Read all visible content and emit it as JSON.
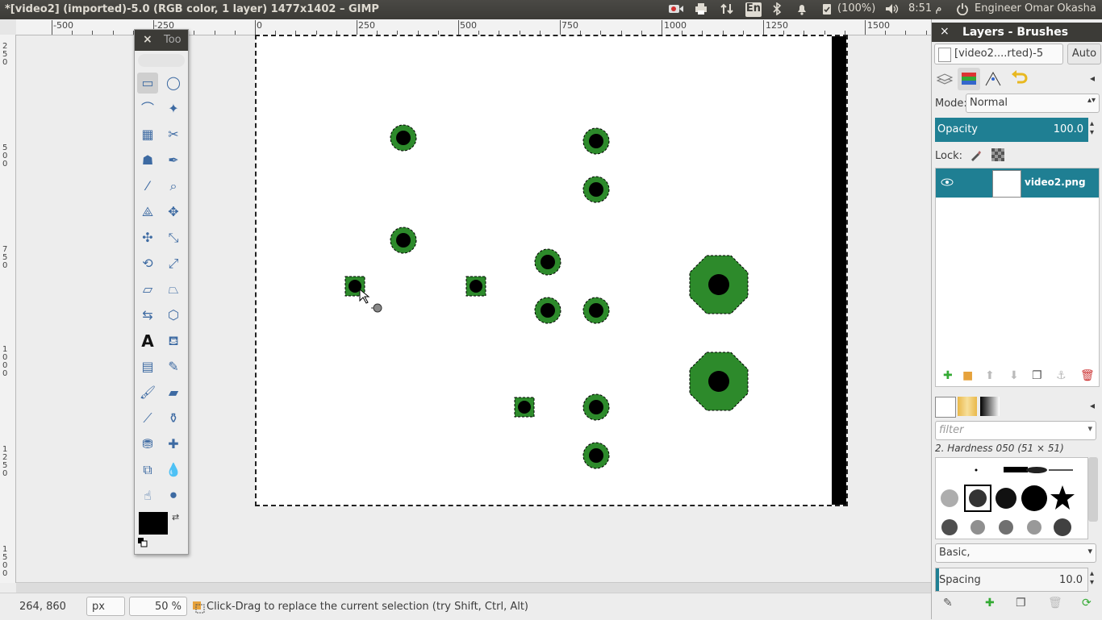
{
  "window": {
    "title": "*[video2] (imported)-5.0 (RGB color, 1 layer) 1477x1402 – GIMP"
  },
  "system": {
    "lang": "En",
    "battery": "(100%)",
    "time": "8:51 م",
    "user": "Engineer Omar Okasha"
  },
  "ruler": {
    "labels": [
      "-500",
      "-250",
      "0",
      "250",
      "500",
      "750",
      "1000",
      "1250",
      "1500"
    ],
    "vlabels": [
      "250",
      "500",
      "750",
      "1000",
      "1250",
      "1500"
    ]
  },
  "toolbox": {
    "close": "×",
    "title": "Too"
  },
  "status": {
    "coords": "264, 860",
    "unit": "px",
    "zoom": "50 %",
    "message": "Click-Drag to replace the current selection (try Shift, Ctrl, Alt)"
  },
  "panel": {
    "close": "×",
    "title": "Layers - Brushes",
    "image_select": "[video2....rted)-5",
    "auto_button": "Auto",
    "mode_label": "Mode:",
    "mode_value": "Normal",
    "opacity_label": "Opacity",
    "opacity_value": "100.0",
    "lock_label": "Lock:",
    "layer_name": "video2.png",
    "brush_filter_placeholder": "filter",
    "brush_name": "2. Hardness 050 (51 × 51)",
    "brush_tag": "Basic,",
    "spacing_label": "Spacing",
    "spacing_value": "10.0"
  },
  "colors": {
    "topbar": "#3c3b37",
    "green": "#2d8a2b",
    "accent_teal": "#1f7f93"
  }
}
